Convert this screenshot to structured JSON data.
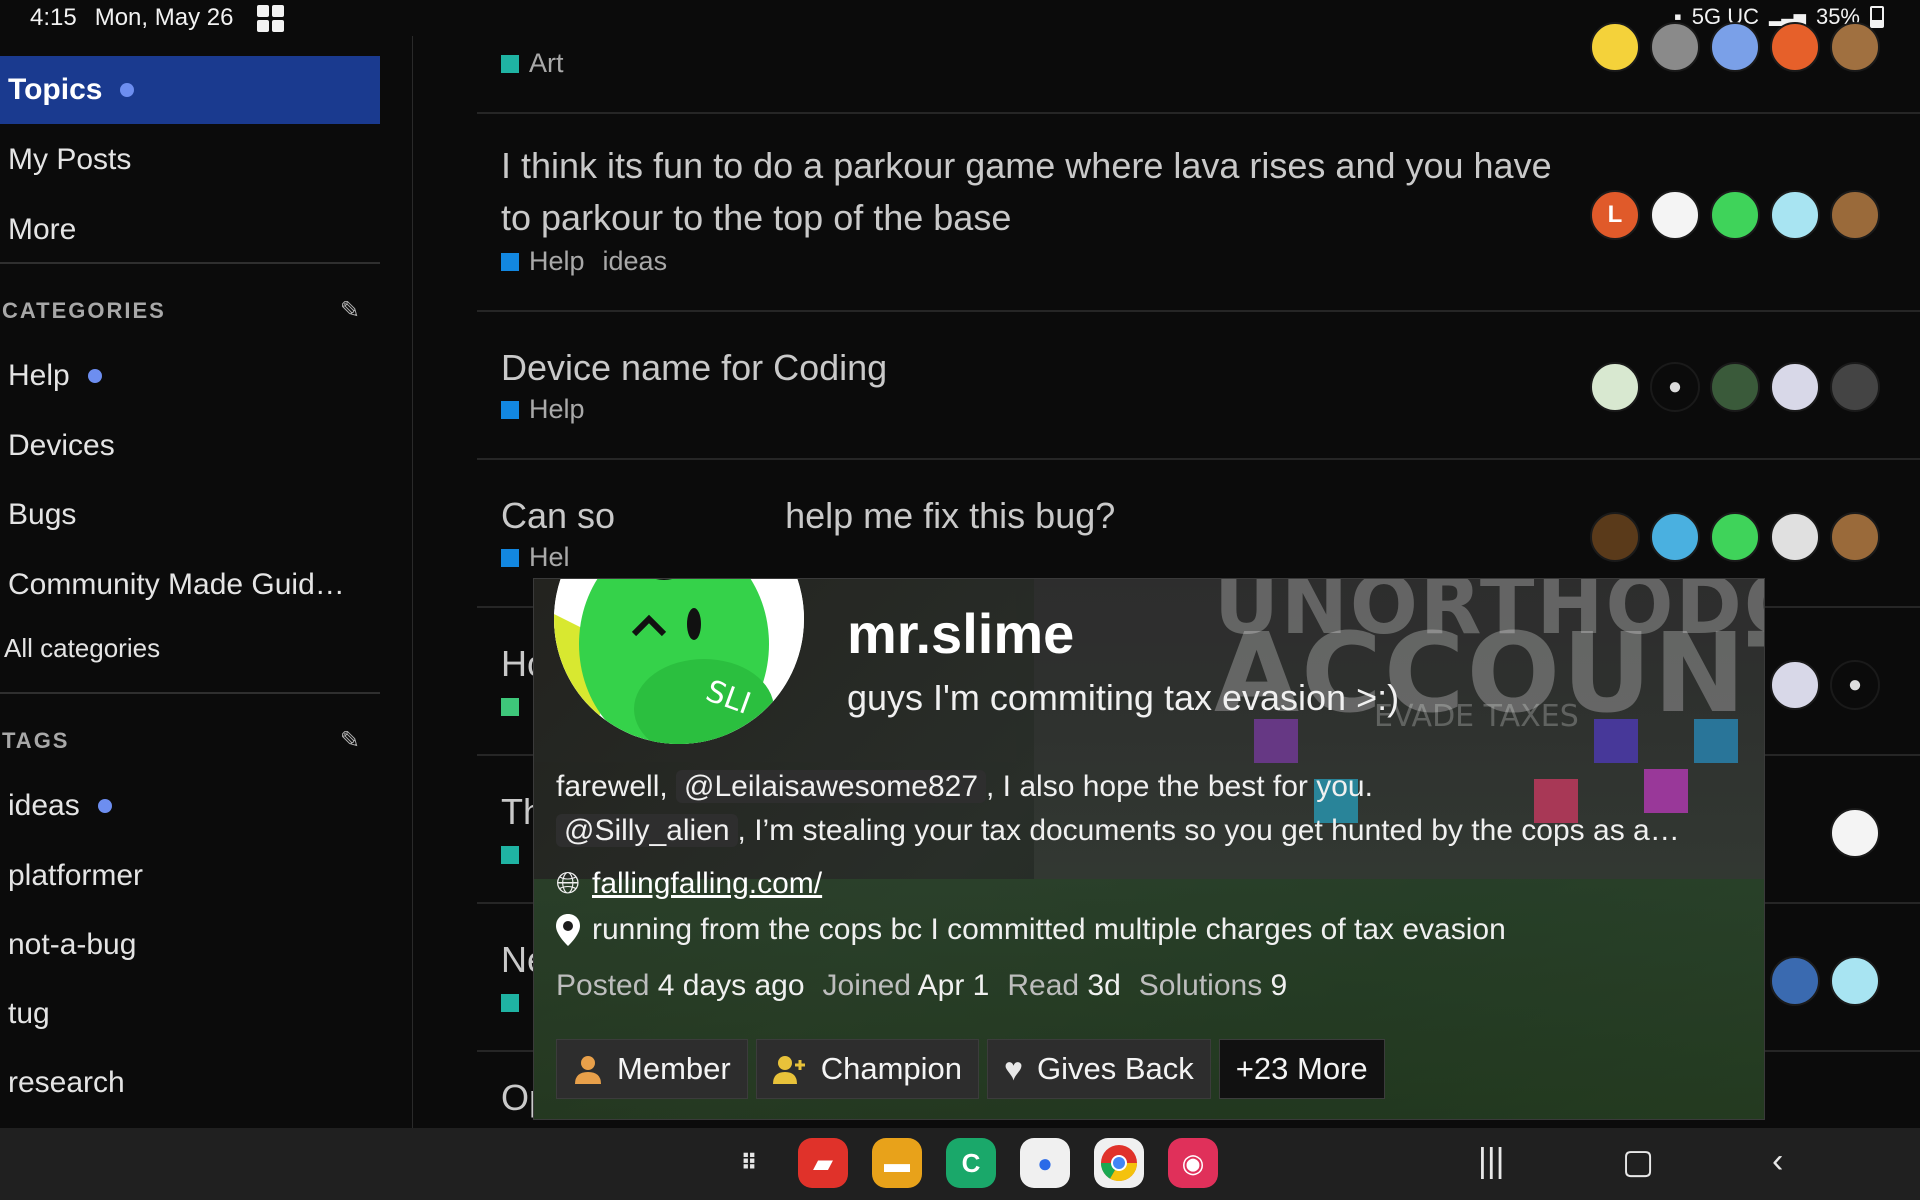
{
  "status_bar": {
    "time": "4:15",
    "date": "Mon, May 26",
    "network": "5G UC",
    "battery": "35%"
  },
  "sidebar": {
    "nav": [
      {
        "label": "Topics",
        "active": true,
        "dot": true
      },
      {
        "label": "My Posts"
      },
      {
        "label": "More"
      }
    ],
    "categories_heading": "CATEGORIES",
    "categories": [
      {
        "label": "Help",
        "dot": true
      },
      {
        "label": "Devices"
      },
      {
        "label": "Bugs"
      },
      {
        "label": "Community Made Guid…"
      }
    ],
    "all_categories": "All categories",
    "tags_heading": "TAGS",
    "tags": [
      {
        "label": "ideas",
        "dot": true
      },
      {
        "label": "platformer"
      },
      {
        "label": "not-a-bug"
      },
      {
        "label": "tug"
      },
      {
        "label": "research"
      }
    ]
  },
  "topics": [
    {
      "category": "Art",
      "category_color": "#1fb3a3"
    },
    {
      "title_line1": "I think its fun to do a parkour game where lava rises and you have",
      "title_line2": "to parkour to the top of the base",
      "category": "Help",
      "category_color": "#1287e0",
      "tag": "ideas",
      "avatar_letter": "L"
    },
    {
      "title": "Device name for Coding",
      "category": "Help",
      "category_color": "#1287e0"
    },
    {
      "title_visible_left": "Can so",
      "title_visible_right": "help me fix this bug?",
      "category": "Hel",
      "category_color": "#1287e0"
    },
    {
      "title": "Ho",
      "category_color": "#3ec77a"
    },
    {
      "title": "Th",
      "category_color": "#1fb3a3"
    },
    {
      "title": "Ne",
      "category_color": "#1fb3a3"
    },
    {
      "title": "Op"
    }
  ],
  "user_card": {
    "username": "mr.slime",
    "status": "guys I'm commiting tax evasion >:)",
    "bio_line1_pre": "farewell, ",
    "bio_mention1": "@Leilaisawesome827",
    "bio_line1_post": ", I also hope the best for you.",
    "bio_mention2": "@Silly_alien",
    "bio_line2_post": ", I’m stealing your tax documents so you get hunted by the cops as a…",
    "website": "fallingfalling.com/",
    "location": "running from the cops bc I committed multiple charges of tax evasion",
    "stats": {
      "posted_label": "Posted",
      "posted_value": "4 days ago",
      "joined_label": "Joined",
      "joined_value": "Apr 1",
      "read_label": "Read",
      "read_value": "3d",
      "solutions_label": "Solutions",
      "solutions_value": "9"
    },
    "badges": [
      {
        "label": "Member",
        "icon": "person-icon"
      },
      {
        "label": "Champion",
        "icon": "person-plus-icon"
      },
      {
        "label": "Gives Back",
        "icon": "heart-icon"
      }
    ],
    "more_badges": "+23 More",
    "background_text": "ACCOUNTING",
    "background_text_top": "UNORTHODOX",
    "background_subtext": "EVADE TAXES"
  },
  "dock_apps": [
    "apps-grid-icon",
    "notes-app-icon",
    "files-app-icon",
    "phone-app-icon",
    "messages-app-icon",
    "chrome-app-icon",
    "camera-app-icon"
  ]
}
